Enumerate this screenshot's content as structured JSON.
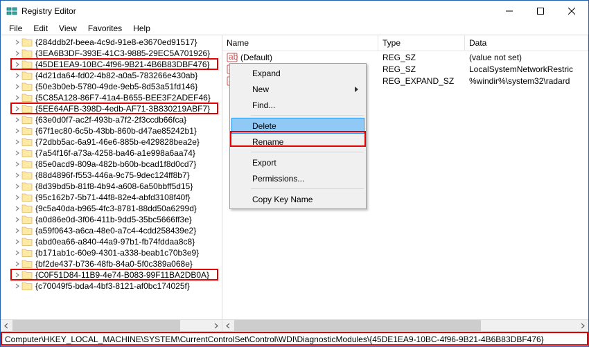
{
  "window": {
    "title": "Registry Editor"
  },
  "menu": {
    "file": "File",
    "edit": "Edit",
    "view": "View",
    "favorites": "Favorites",
    "help": "Help"
  },
  "tree": {
    "items": [
      "{284ddb2f-beea-4c9d-91e8-e3670ed91517}",
      "{3EA6B3DF-393E-41C3-9885-29EC5A701926}",
      "{45DE1EA9-10BC-4f96-9B21-4B6B83DBF476}",
      "{4d21da64-fd02-4b82-a0a5-783266e430ab}",
      "{50e3b0eb-5780-49de-9eb5-8d53a51fd146}",
      "{5C85A128-86F7-41a4-B655-BEE3F2ADEF46}",
      "{5EE64AFB-398D-4edb-AF71-3B830219ABF7}",
      "{63e0d0f7-ac2f-493b-a7f2-2f3ccdb66fca}",
      "{67f1ec80-6c5b-43bb-860b-d47ae85242b1}",
      "{72dbb5ac-6a91-46e6-885b-e429828bea2e}",
      "{7a54f16f-a73a-4258-ba46-a1e998a6aa74}",
      "{85e0acd9-809a-482b-b60b-bcad1f8d0cd7}",
      "{88d4896f-f553-446a-9c75-9dec124ff8b7}",
      "{8d39bd5b-81f8-4b94-a608-6a50bbff5d15}",
      "{95c162b7-5b71-44f8-82e4-abfd3108f40f}",
      "{9c5a40da-b965-4fc3-8781-88dd50a6299d}",
      "{a0d86e0d-3f06-411b-9dd5-35bc5666ff3e}",
      "{a59f0643-a6ca-48e0-a7c4-4cdd258439e2}",
      "{abd0ea66-a840-44a9-97b1-fb74fddaa8c8}",
      "{b171ab1c-60e9-4301-a338-beab1c70b3e9}",
      "{bf2de437-b736-48fb-84a0-5f0c389a068e}",
      "{C0F51D84-11B9-4e74-B083-99F11BA2DB0A}",
      "{c70049f5-bda4-4bf3-8121-af0bc174025f}"
    ],
    "highlighted_indices": [
      2,
      6,
      21
    ]
  },
  "list": {
    "columns": {
      "name": "Name",
      "type": "Type",
      "data": "Data"
    },
    "rows": [
      {
        "icon": "string",
        "name": "(Default)",
        "type": "REG_SZ",
        "data": "(value not set)"
      },
      {
        "icon": "string",
        "name": "",
        "type": "REG_SZ",
        "data": "LocalSystemNetworkRestric"
      },
      {
        "icon": "string",
        "name": "",
        "type": "REG_EXPAND_SZ",
        "data": "%windir%\\system32\\radard"
      }
    ]
  },
  "context_menu": {
    "expand": "Expand",
    "new": "New",
    "find": "Find...",
    "delete": "Delete",
    "rename": "Rename",
    "export": "Export",
    "permissions": "Permissions...",
    "copy_key_name": "Copy Key Name"
  },
  "status": {
    "path": "Computer\\HKEY_LOCAL_MACHINE\\SYSTEM\\CurrentControlSet\\Control\\WDI\\DiagnosticModules\\{45DE1EA9-10BC-4f96-9B21-4B6B83DBF476}"
  }
}
